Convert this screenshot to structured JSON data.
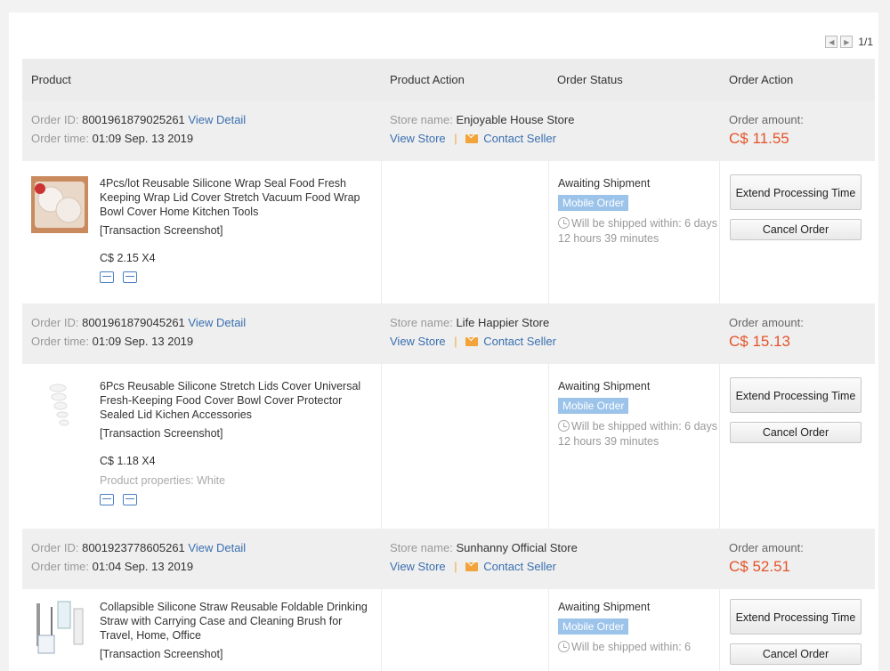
{
  "pager": {
    "page_text": "1/1"
  },
  "header": {
    "product": "Product",
    "product_action": "Product Action",
    "order_status": "Order Status",
    "order_action": "Order Action"
  },
  "labels": {
    "order_id": "Order ID:",
    "order_time": "Order time:",
    "store_name": "Store name:",
    "view_detail": "View Detail",
    "view_store": "View Store",
    "contact_seller": "Contact Seller",
    "order_amount": "Order amount:",
    "transaction_screenshot": "[Transaction Screenshot]",
    "awaiting_shipment": "Awaiting Shipment",
    "mobile_order": "Mobile Order",
    "extend_processing_time": "Extend Processing Time",
    "cancel_order": "Cancel Order",
    "separator": "|"
  },
  "orders": [
    {
      "order_id": "8001961879025261",
      "order_time": "01:09 Sep. 13 2019",
      "store_name": "Enjoyable House Store",
      "amount": "C$ 11.55",
      "product_title": "4Pcs/lot Reusable Silicone Wrap Seal Food Fresh Keeping Wrap Lid Cover Stretch Vacuum Food Wrap Bowl Cover Home Kitchen Tools",
      "price_qty": "C$ 2.15 X4",
      "properties": "",
      "ship_text": "Will be shipped within: 6 days 12 hours 39 minutes"
    },
    {
      "order_id": "8001961879045261",
      "order_time": "01:09 Sep. 13 2019",
      "store_name": "Life Happier Store",
      "amount": "C$ 15.13",
      "product_title": "6Pcs Reusable Silicone Stretch Lids Cover Universal Fresh-Keeping Food Cover Bowl Cover Protector Sealed Lid Kichen Accessories",
      "price_qty": "C$ 1.18 X4",
      "properties": "Product properties: White",
      "ship_text": "Will be shipped within: 6 days 12 hours 39 minutes"
    },
    {
      "order_id": "8001923778605261",
      "order_time": "01:04 Sep. 13 2019",
      "store_name": "Sunhanny Official Store",
      "amount": "C$ 52.51",
      "product_title": "Collapsible Silicone Straw Reusable Foldable Drinking Straw with Carrying Case and Cleaning Brush for Travel, Home, Office",
      "price_qty": "",
      "properties": "",
      "ship_text": "Will be shipped within: 6"
    }
  ]
}
